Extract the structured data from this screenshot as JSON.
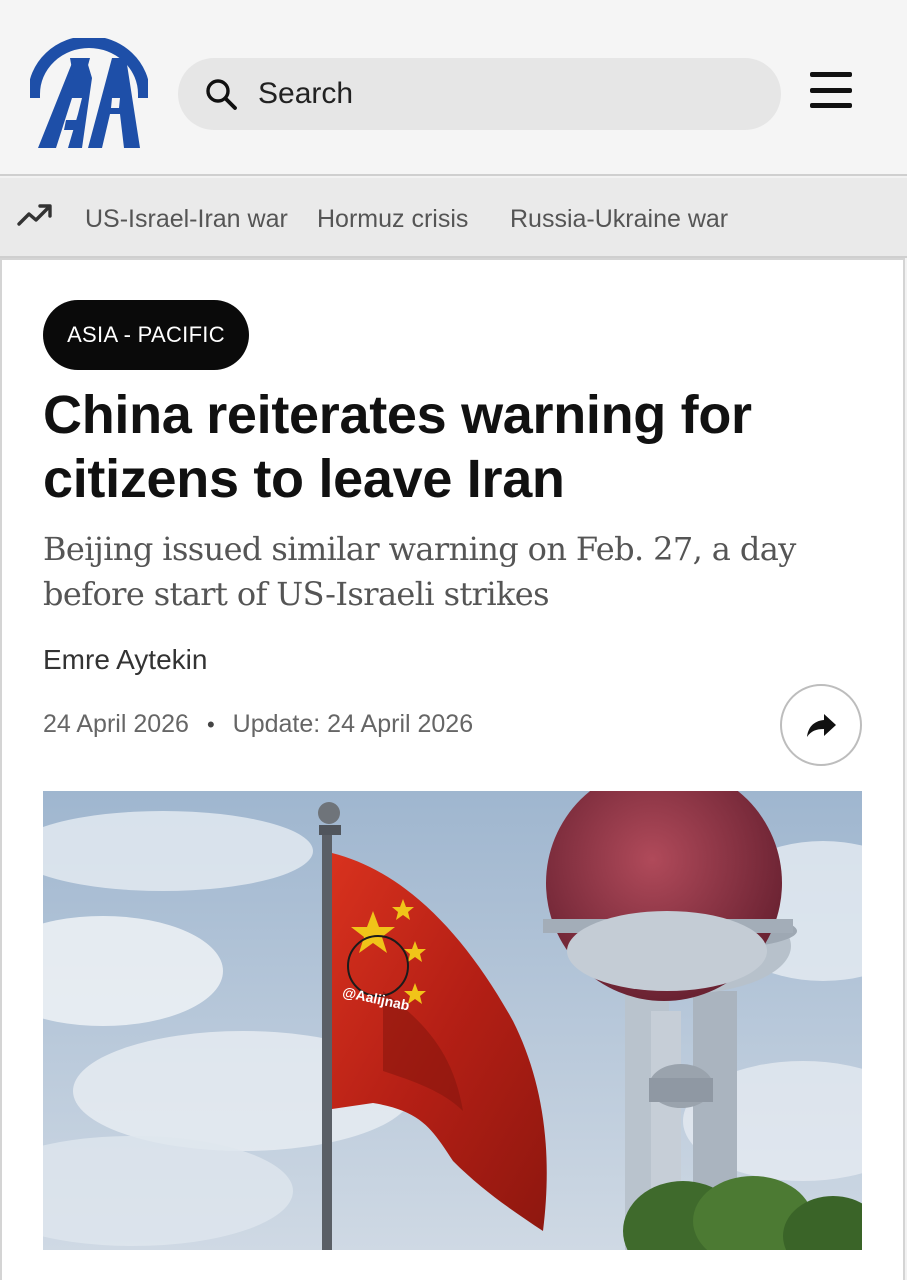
{
  "header": {
    "logo_text": "AA",
    "search_placeholder": "Search",
    "search_icon": "search-icon",
    "menu_icon": "hamburger-menu-icon"
  },
  "trending": {
    "icon": "trending-up-icon",
    "items": [
      "US-Israel-Iran war",
      "Hormuz crisis",
      "Russia-Ukraine war"
    ]
  },
  "article": {
    "category": "ASIA - PACIFIC",
    "title": "China reiterates warning for citizens to leave Iran",
    "subtitle": "Beijing issued similar warning on Feb. 27, a day before start of US-Israeli strikes",
    "author": "Emre Aytekin",
    "date": "24 April 2026",
    "separator": "•",
    "updated": "Update: 24 April 2026",
    "share_icon": "share-arrow-icon",
    "image": {
      "subject": "Chinese flag on flagpole beside Oriental Pearl Tower",
      "watermark": "@Aalijnab"
    }
  },
  "colors": {
    "brand_blue": "#1e4fa8",
    "badge_bg": "#0a0a0a",
    "title": "#111111",
    "subtitle": "#555555"
  }
}
